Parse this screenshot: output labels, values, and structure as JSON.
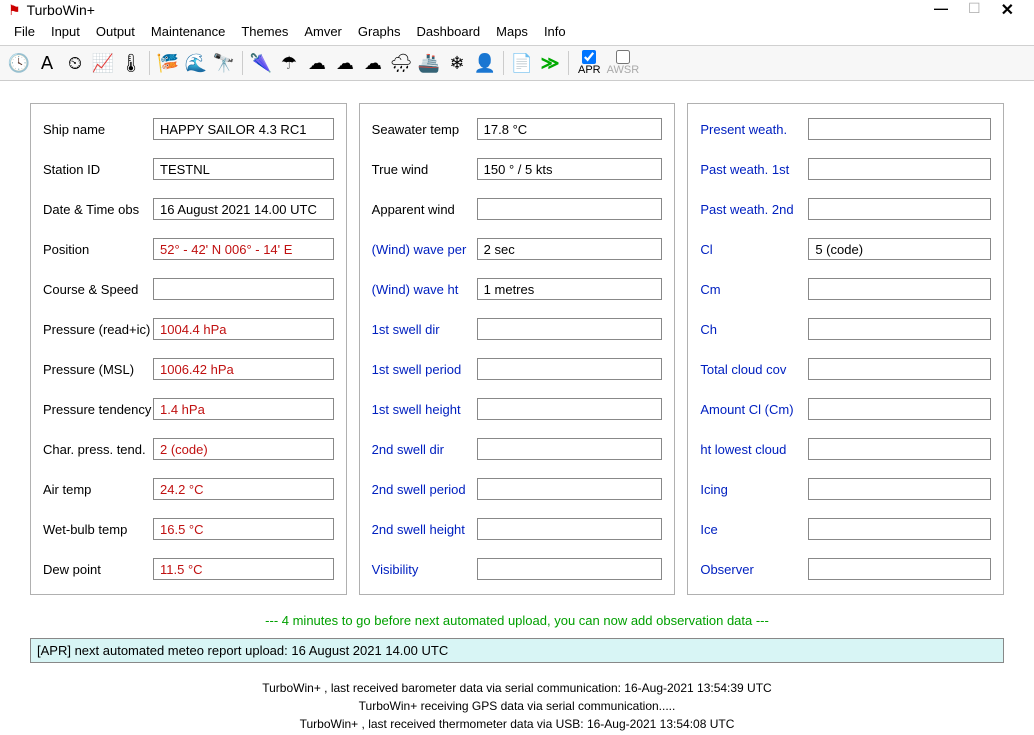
{
  "window": {
    "title": "TurboWin+"
  },
  "menu": [
    "File",
    "Input",
    "Output",
    "Maintenance",
    "Themes",
    "Amver",
    "Graphs",
    "Dashboard",
    "Maps",
    "Info"
  ],
  "toolbar_checks": {
    "apr": "APR",
    "awsr": "AWSR"
  },
  "col1": [
    {
      "label": "Ship name",
      "value": "HAPPY SAILOR 4.3 RC1"
    },
    {
      "label": "Station ID",
      "value": "TESTNL"
    },
    {
      "label": "Date & Time obs",
      "value": "16 August 2021  14.00 UTC"
    },
    {
      "label": "Position",
      "value": "52° - 42' N  006° - 14' E"
    },
    {
      "label": "Course & Speed",
      "value": ""
    },
    {
      "label": "Pressure (read+ic)",
      "value": "1004.4 hPa"
    },
    {
      "label": "Pressure (MSL)",
      "value": "1006.42 hPa"
    },
    {
      "label": "Pressure tendency",
      "value": "1.4 hPa"
    },
    {
      "label": "Char. press. tend.",
      "value": "2 (code)"
    },
    {
      "label": "Air temp",
      "value": "24.2 °C"
    },
    {
      "label": "Wet-bulb temp",
      "value": "16.5 °C"
    },
    {
      "label": "Dew point",
      "value": "11.5 °C"
    }
  ],
  "col2": [
    {
      "label": "Seawater temp",
      "value": "17.8 °C"
    },
    {
      "label": "True wind",
      "value": "150 ° / 5 kts"
    },
    {
      "label": "Apparent wind",
      "value": ""
    },
    {
      "label": "(Wind) wave per",
      "value": "2 sec"
    },
    {
      "label": "(Wind) wave ht",
      "value": "1 metres"
    },
    {
      "label": "1st swell dir",
      "value": ""
    },
    {
      "label": "1st swell period",
      "value": ""
    },
    {
      "label": "1st swell height",
      "value": ""
    },
    {
      "label": "2nd swell dir",
      "value": ""
    },
    {
      "label": "2nd swell period",
      "value": ""
    },
    {
      "label": "2nd swell height",
      "value": ""
    },
    {
      "label": "Visibility",
      "value": ""
    }
  ],
  "col3": [
    {
      "label": "Present weath.",
      "value": ""
    },
    {
      "label": "Past weath. 1st",
      "value": ""
    },
    {
      "label": "Past weath. 2nd",
      "value": ""
    },
    {
      "label": "Cl",
      "value": "5 (code)"
    },
    {
      "label": "Cm",
      "value": ""
    },
    {
      "label": "Ch",
      "value": ""
    },
    {
      "label": "Total cloud cov",
      "value": ""
    },
    {
      "label": "Amount Cl (Cm)",
      "value": ""
    },
    {
      "label": "ht lowest cloud",
      "value": ""
    },
    {
      "label": "Icing",
      "value": ""
    },
    {
      "label": "Ice",
      "value": ""
    },
    {
      "label": "Observer",
      "value": ""
    }
  ],
  "status": "--- 4 minutes to go before next automated upload, you can now add observation data ---",
  "report": "[APR] next automated meteo report upload: 16 August 2021 14.00 UTC",
  "footer": [
    "TurboWin+ , last received barometer data via serial communication: 16-Aug-2021 13:54:39 UTC",
    "TurboWin+ receiving GPS data via serial communication.....",
    "TurboWin+ , last received thermometer data via USB: 16-Aug-2021 13:54:08 UTC"
  ]
}
